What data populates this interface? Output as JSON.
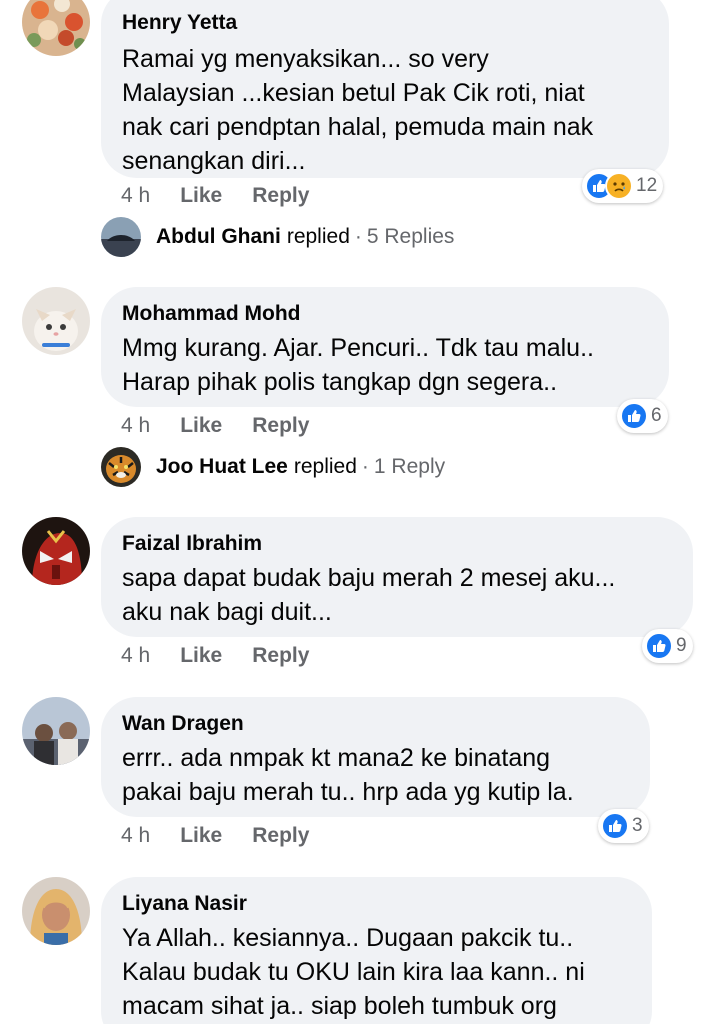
{
  "comments": [
    {
      "author": "Henry Yetta",
      "text": "Ramai yg menyaksikan... so very\nMalaysian ...kesian betul Pak Cik roti, niat\nnak cari pendptan halal, pemuda main nak\nsenangkan diri...",
      "time": "4 h",
      "like_label": "Like",
      "reply_label": "Reply",
      "reaction_icons": [
        "like-icon",
        "sad-icon"
      ],
      "reaction_count": "12",
      "replied": {
        "name": "Abdul Ghani",
        "word": "replied",
        "dot": "·",
        "count": "5 Replies"
      }
    },
    {
      "author": "Mohammad Mohd",
      "text": "Mmg kurang. Ajar. Pencuri.. Tdk tau malu..\nHarap pihak polis tangkap dgn segera..",
      "time": "4 h",
      "like_label": "Like",
      "reply_label": "Reply",
      "reaction_icons": [
        "like-icon"
      ],
      "reaction_count": "6",
      "replied": {
        "name": "Joo Huat Lee",
        "word": "replied",
        "dot": "·",
        "count": "1 Reply"
      }
    },
    {
      "author": "Faizal Ibrahim",
      "text": "sapa dapat budak baju merah 2 mesej aku...\naku nak bagi duit...",
      "time": "4 h",
      "like_label": "Like",
      "reply_label": "Reply",
      "reaction_icons": [
        "like-icon"
      ],
      "reaction_count": "9"
    },
    {
      "author": "Wan Dragen",
      "text": "errr.. ada nmpak kt mana2 ke binatang\npakai baju merah tu.. hrp ada yg kutip la.",
      "time": "4 h",
      "like_label": "Like",
      "reply_label": "Reply",
      "reaction_icons": [
        "like-icon"
      ],
      "reaction_count": "3"
    },
    {
      "author": "Liyana Nasir",
      "text": "Ya Allah.. kesiannya.. Dugaan pakcik tu..\nKalau budak tu OKU lain kira laa kann.. ni\nmacam sihat ja.. siap boleh tumbuk org"
    }
  ],
  "colors": {
    "bubble": "#f0f2f5",
    "meta": "#65676b",
    "like_blue": "#1877f2",
    "sad_yellow": "#f7b125"
  }
}
